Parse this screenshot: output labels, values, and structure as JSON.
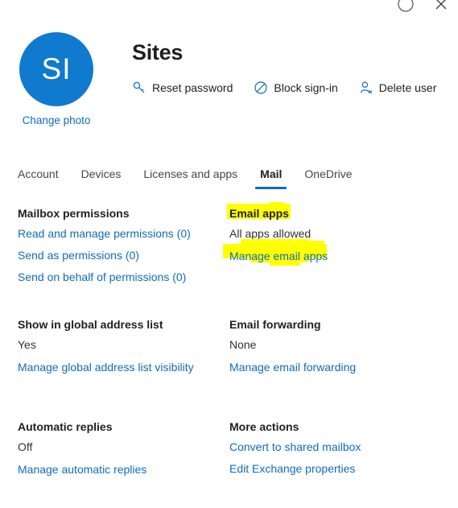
{
  "window": {
    "minimize_icon": "circle-icon",
    "close_icon": "close-icon"
  },
  "profile": {
    "avatar_initials": "SI",
    "avatar_color": "#0f7ace",
    "change_photo_label": "Change photo",
    "display_name": "Sites",
    "actions": [
      {
        "label": "Reset password",
        "icon": "key-icon"
      },
      {
        "label": "Block sign-in",
        "icon": "block-icon"
      },
      {
        "label": "Delete user",
        "icon": "delete-user-icon"
      }
    ]
  },
  "tabs": [
    {
      "label": "Account",
      "selected": false
    },
    {
      "label": "Devices",
      "selected": false
    },
    {
      "label": "Licenses and apps",
      "selected": false
    },
    {
      "label": "Mail",
      "selected": true
    },
    {
      "label": "OneDrive",
      "selected": false
    }
  ],
  "accent_color": "#0f6cbd",
  "highlight_color": "#ffff00",
  "sections": {
    "mailbox_permissions": {
      "title": "Mailbox permissions",
      "links": [
        "Read and manage permissions (0)",
        "Send as permissions (0)",
        "Send on behalf of permissions (0)"
      ]
    },
    "email_apps": {
      "title": "Email apps",
      "value": "All apps allowed",
      "link": "Manage email apps"
    },
    "global_address_list": {
      "title": "Show in global address list",
      "value": "Yes",
      "link": "Manage global address list visibility"
    },
    "email_forwarding": {
      "title": "Email forwarding",
      "value": "None",
      "link": "Manage email forwarding"
    },
    "automatic_replies": {
      "title": "Automatic replies",
      "value": "Off",
      "link": "Manage automatic replies"
    },
    "more_actions": {
      "title": "More actions",
      "links": [
        "Convert to shared mailbox",
        "Edit Exchange properties"
      ]
    }
  }
}
